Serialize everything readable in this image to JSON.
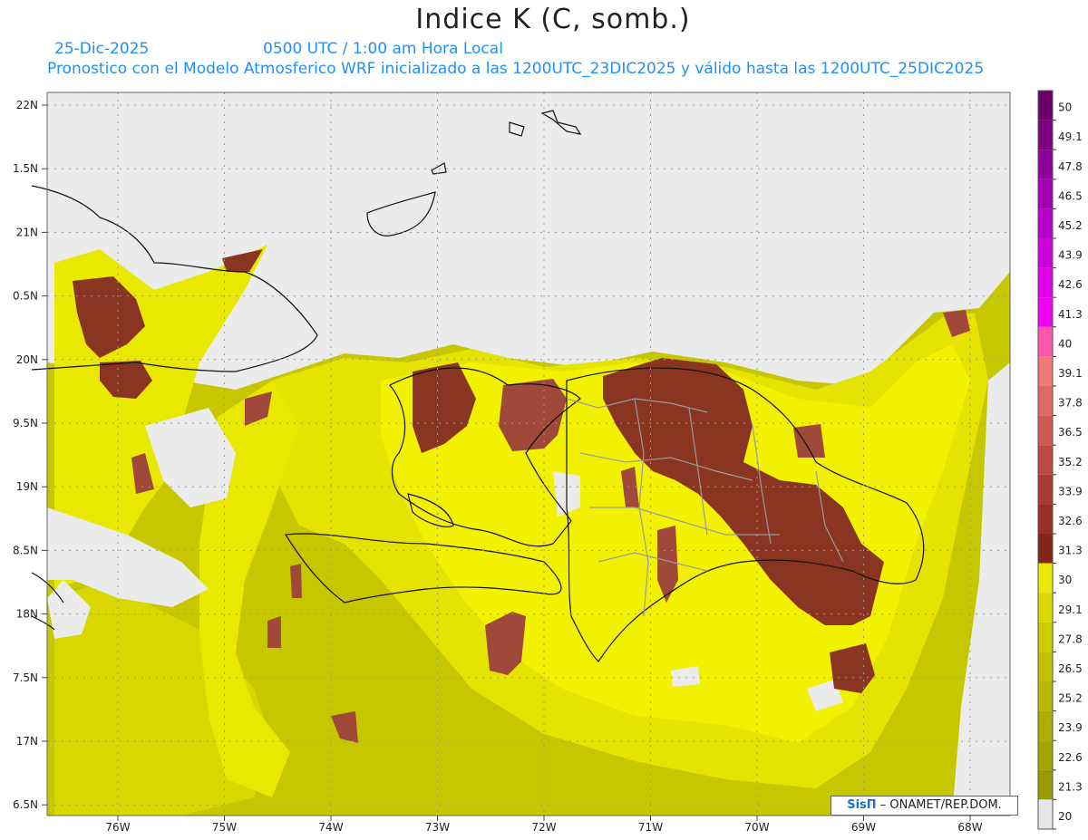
{
  "header": {
    "title": "Indice K (C, somb.)",
    "date": "25-Dic-2025",
    "time": "0500 UTC / 1:00 am Hora Local",
    "description": "Pronostico con el Modelo Atmosferico WRF inicializado a las 1200UTC_23DIC2025 y válido hasta las  1200UTC_25DIC2025"
  },
  "map": {
    "lat_labels": [
      "22N",
      "1.5N",
      "21N",
      "0.5N",
      "20N",
      "9.5N",
      "19N",
      "8.5N",
      "18N",
      "7.5N",
      "17N",
      "6.5N"
    ],
    "lon_labels": [
      "76W",
      "75W",
      "74W",
      "73W",
      "72W",
      "71W",
      "70W",
      "69W",
      "68W"
    ]
  },
  "colorbar": {
    "levels": [
      "50",
      "49.1",
      "47.8",
      "46.5",
      "45.2",
      "43.9",
      "42.6",
      "41.3",
      "40",
      "39.1",
      "37.8",
      "36.5",
      "35.2",
      "33.9",
      "32.6",
      "31.3",
      "30",
      "29.1",
      "27.8",
      "26.5",
      "25.2",
      "23.9",
      "22.6",
      "21.3",
      "20"
    ],
    "colors": [
      "#6b0068",
      "#7d0080",
      "#8f009a",
      "#a300b4",
      "#b800cc",
      "#cc00dd",
      "#e000ea",
      "#f000f5",
      "#ff55aa",
      "#ee7a78",
      "#df6a62",
      "#cf5a50",
      "#bd4a40",
      "#aa3a30",
      "#963022",
      "#852718",
      "#e8e800",
      "#d9d900",
      "#cccc00",
      "#c2c200",
      "#b8b800",
      "#aeae00",
      "#a4a400",
      "#9a9a00",
      "#e6e6e6"
    ],
    "palette": {
      "dark_brown": "#8a3522",
      "mid_brown": "#a0483a",
      "light_brown": "#c45a58",
      "yellow": "#f2f200",
      "olive": "#c8c800",
      "no_data": "#ebebeb"
    }
  },
  "credit": {
    "logo": "SisΠ",
    "text": " – ONAMET/REP.DOM."
  }
}
